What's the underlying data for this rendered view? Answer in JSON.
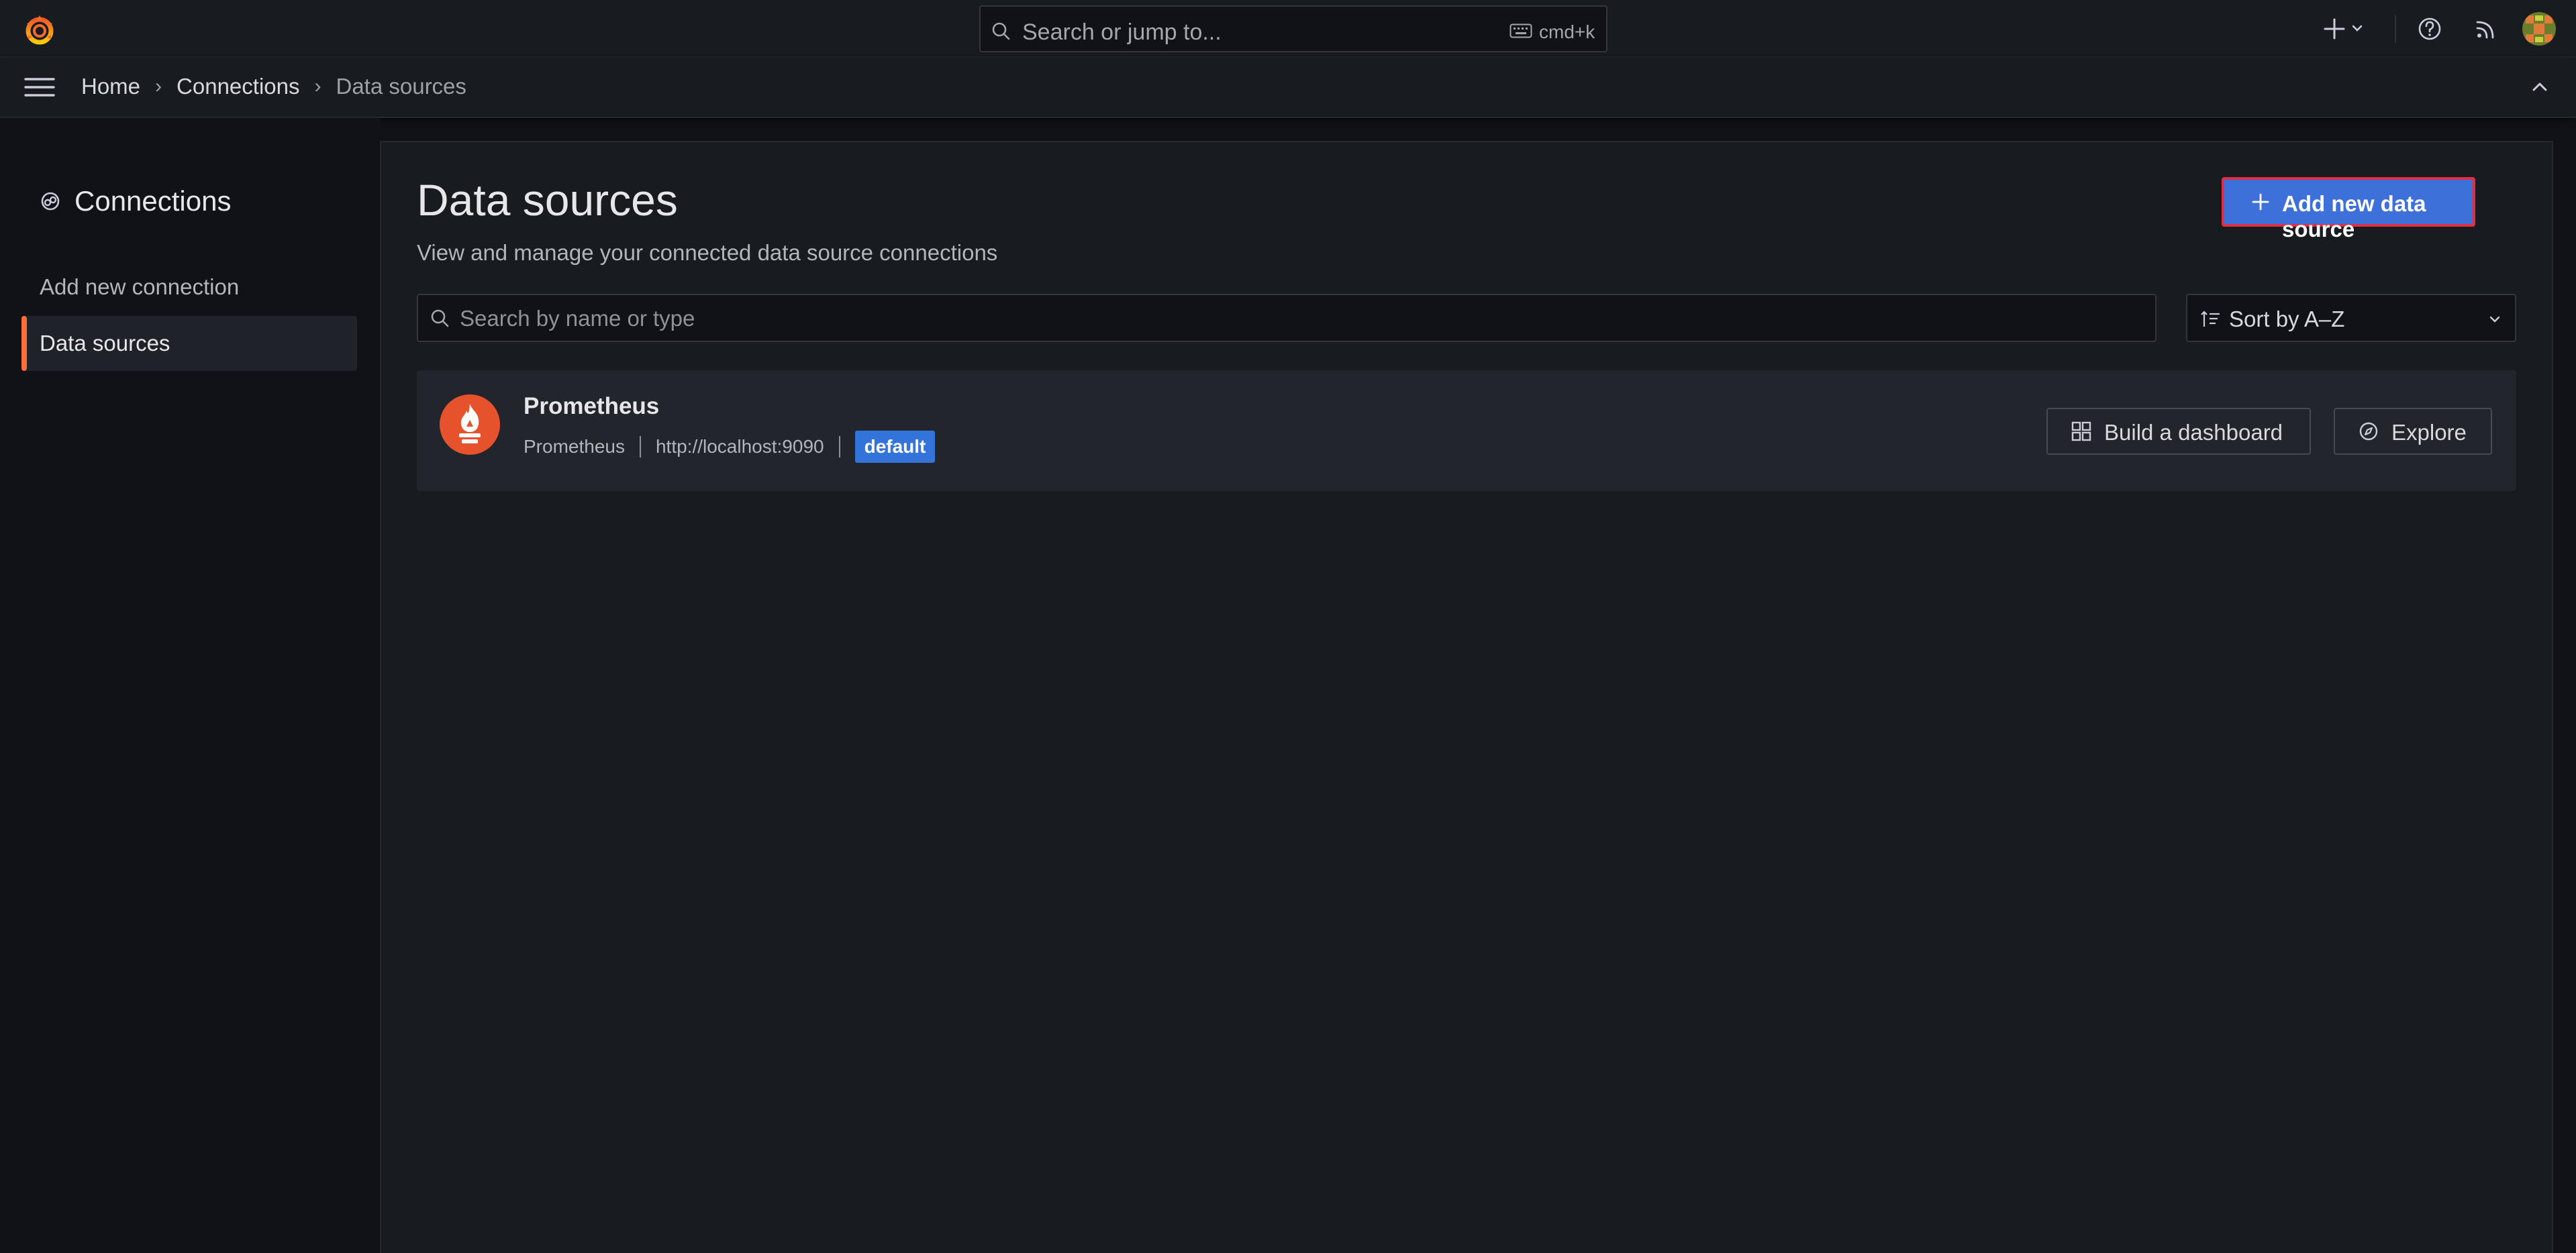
{
  "topbar": {
    "search_placeholder": "Search or jump to...",
    "shortcut": "cmd+k",
    "icons": [
      "grafana-logo-icon",
      "search-icon",
      "keyboard-icon",
      "plus-icon",
      "chevron-down-icon",
      "help-icon",
      "rss-icon",
      "avatar"
    ]
  },
  "breadcrumb": [
    "Home",
    "Connections",
    "Data sources"
  ],
  "sidebar": {
    "title": "Connections",
    "items": [
      {
        "label": "Add new connection",
        "active": false
      },
      {
        "label": "Data sources",
        "active": true
      }
    ]
  },
  "main": {
    "title": "Data sources",
    "subtitle": "View and manage your connected data source connections",
    "add_button": "Add new data source",
    "search_placeholder": "Search by name or type",
    "search_value": "",
    "sort_label": "Sort by A–Z"
  },
  "datasources": [
    {
      "name": "Prometheus",
      "type": "Prometheus",
      "url": "http://localhost:9090",
      "badge": "default",
      "actions": [
        "Build a dashboard",
        "Explore"
      ]
    }
  ],
  "colors": {
    "accent": "#ff6d3a",
    "primary": "#3d71d9",
    "highlight_border": "#e02f44",
    "badge": "#3274d9",
    "prometheus": "#e6522c"
  }
}
